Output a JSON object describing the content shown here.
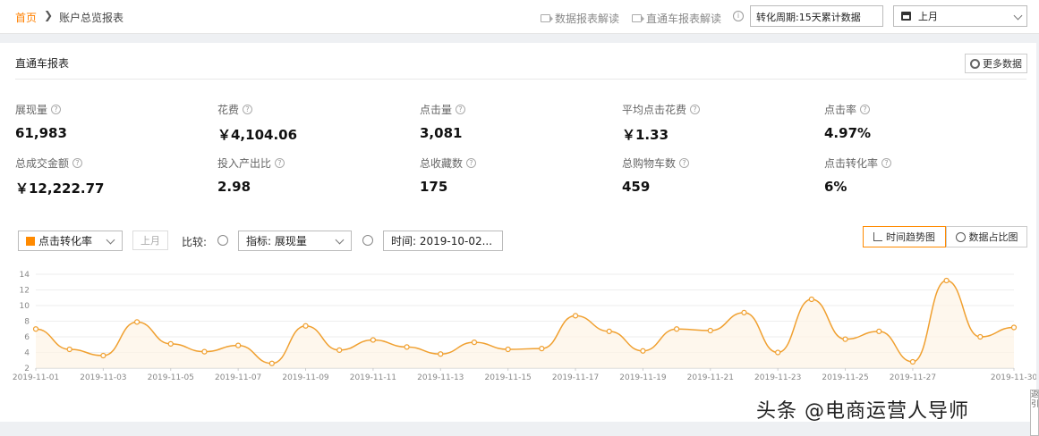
{
  "breadcrumb": {
    "home": "首页",
    "separator": "❯",
    "current": "账户总览报表"
  },
  "header": {
    "doc_link_1": "数据报表解读",
    "doc_link_2": "直通车报表解读",
    "info_symbol": "i",
    "period": "转化周期:15天累计数据",
    "month": "上月"
  },
  "card": {
    "title": "直通车报表",
    "more_button": "更多数据"
  },
  "metrics": [
    {
      "label": "展现量",
      "value": "61,983"
    },
    {
      "label": "花费",
      "value": "￥4,104.06"
    },
    {
      "label": "点击量",
      "value": "3,081"
    },
    {
      "label": "平均点击花费",
      "value": "￥1.33"
    },
    {
      "label": "点击率",
      "value": "4.97%"
    },
    {
      "label": "总成交金额",
      "value": "￥12,222.77"
    },
    {
      "label": "投入产出比",
      "value": "2.98"
    },
    {
      "label": "总收藏数",
      "value": "175"
    },
    {
      "label": "总购物车数",
      "value": "459"
    },
    {
      "label": "点击转化率",
      "value": "6%"
    }
  ],
  "controls": {
    "metric_select": "点击转化率",
    "last_month_button": "上月",
    "compare_label": "比较:",
    "indicator_select": "指标:  展现量",
    "time_field": "时间:  2019-10-02...",
    "trend_button": "时间趋势图",
    "ratio_button": "数据占比图"
  },
  "colors": {
    "accent": "#ff8a00",
    "line": "#f0a030",
    "home_link": "#ff8000"
  },
  "chart_data": {
    "type": "line",
    "x": [
      "2019-11-01",
      "2019-11-02",
      "2019-11-03",
      "2019-11-04",
      "2019-11-05",
      "2019-11-06",
      "2019-11-07",
      "2019-11-08",
      "2019-11-09",
      "2019-11-10",
      "2019-11-11",
      "2019-11-12",
      "2019-11-13",
      "2019-11-14",
      "2019-11-15",
      "2019-11-16",
      "2019-11-17",
      "2019-11-18",
      "2019-11-19",
      "2019-11-20",
      "2019-11-21",
      "2019-11-22",
      "2019-11-23",
      "2019-11-24",
      "2019-11-25",
      "2019-11-26",
      "2019-11-27",
      "2019-11-28",
      "2019-11-29",
      "2019-11-30"
    ],
    "xticks": [
      "2019-11-01",
      "2019-11-03",
      "2019-11-05",
      "2019-11-07",
      "2019-11-09",
      "2019-11-11",
      "2019-11-13",
      "2019-11-15",
      "2019-11-17",
      "2019-11-19",
      "2019-11-21",
      "2019-11-23",
      "2019-11-25",
      "2019-11-27",
      "2019-11-30"
    ],
    "series": [
      {
        "values": [
          7.0,
          4.4,
          3.6,
          7.9,
          5.1,
          4.1,
          4.9,
          2.6,
          7.4,
          4.3,
          5.6,
          4.7,
          3.8,
          5.3,
          4.4,
          4.5,
          8.7,
          6.7,
          4.2,
          7.0,
          6.8,
          9.1,
          4.0,
          10.8,
          5.7,
          6.7,
          2.8,
          13.2,
          6.0,
          7.2
        ]
      }
    ],
    "ylim": [
      2,
      14
    ],
    "yticks": [
      2,
      4,
      6,
      8,
      10,
      12,
      14
    ],
    "grid": true
  },
  "watermark": "头条 @电商运营人导师",
  "side_widget": "返引"
}
